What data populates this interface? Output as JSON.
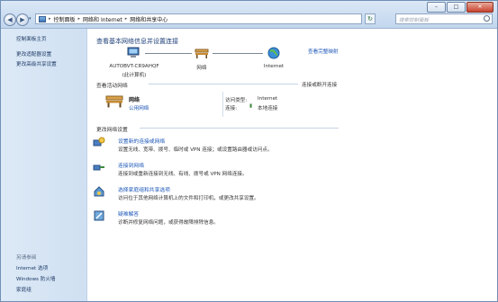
{
  "titlebar": {
    "min": "–",
    "max": "□",
    "close": "✕"
  },
  "address": {
    "segments": [
      "控制面板",
      "网络和 Internet",
      "网络和共享中心"
    ]
  },
  "search": {
    "placeholder": "搜索控制面板"
  },
  "sidebar": {
    "items": [
      {
        "label": "控制面板主页"
      },
      {
        "label": "更改适配器设置"
      },
      {
        "label": "更改高级共享设置"
      }
    ],
    "see_also": {
      "heading": "另请参阅",
      "items": [
        {
          "label": "Internet 选项"
        },
        {
          "label": "Windows 防火墙"
        },
        {
          "label": "家庭组"
        }
      ]
    }
  },
  "main": {
    "title": "查看基本网络信息并设置连接",
    "full_map_link": "查看完整映射",
    "map": {
      "computer_name": "AUTOBVT-CR9AHQF",
      "computer_sub": "(此计算机)",
      "network_label": "网络",
      "internet_label": "Internet"
    },
    "active_header": "查看活动网络",
    "connect_link": "连接或断开连接",
    "network": {
      "name": "网络",
      "type": "公用网络",
      "access_type_label": "访问类型:",
      "access_type_value": "Internet",
      "connections_label": "连接:",
      "connections_value": "本地连接"
    },
    "change_header": "更改网络设置",
    "tasks": [
      {
        "title": "设置新的连接或网络",
        "desc": "设置无线、宽带、拨号、临时或 VPN 连接；或设置路由器或访问点。"
      },
      {
        "title": "连接到网络",
        "desc": "连接到或重新连接到无线、有线、拨号或 VPN 网络连接。"
      },
      {
        "title": "选择家庭组和共享选项",
        "desc": "访问位于其他网络计算机上的文件和打印机，或更改共享设置。"
      },
      {
        "title": "疑难解答",
        "desc": "诊断并修复网络问题，或获得故障排除信息。"
      }
    ]
  }
}
